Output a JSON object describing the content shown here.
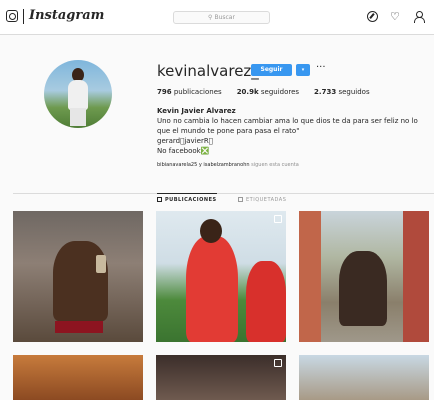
{
  "nav": {
    "logo_text": "Instagram",
    "search_placeholder": "Buscar",
    "icons": [
      "explore-icon",
      "activity-heart-icon",
      "profile-icon"
    ]
  },
  "profile": {
    "username": "kevinalvarez_2",
    "follow_label": "Seguir",
    "dropdown_glyph": "▾",
    "more_glyph": "···",
    "posts_count": "796",
    "posts_label": "publicaciones",
    "followers_count": "20.9k",
    "followers_label": "seguidores",
    "following_count": "2.733",
    "following_label": "seguidos",
    "full_name": "Kevin Javier Alvarez",
    "bio_line1": "Uno no cambia lo hacen cambiar ama lo que dios te da para ser feliz no lo que el mundo te pone para pasa el rato\"",
    "bio_line2": "gerard🏿javierR🏵",
    "bio_line3": "No facebook❎",
    "followed_by_names": "bibianavarela25 y isabelzambranohn",
    "followed_by_suffix": "siguen esta cuenta"
  },
  "tabs": {
    "posts_label": "PUBLICACIONES",
    "tagged_label": "ETIQUETADAS"
  },
  "colors": {
    "accent": "#3897f0",
    "border": "#dbdbdb",
    "background": "#fafafa"
  }
}
